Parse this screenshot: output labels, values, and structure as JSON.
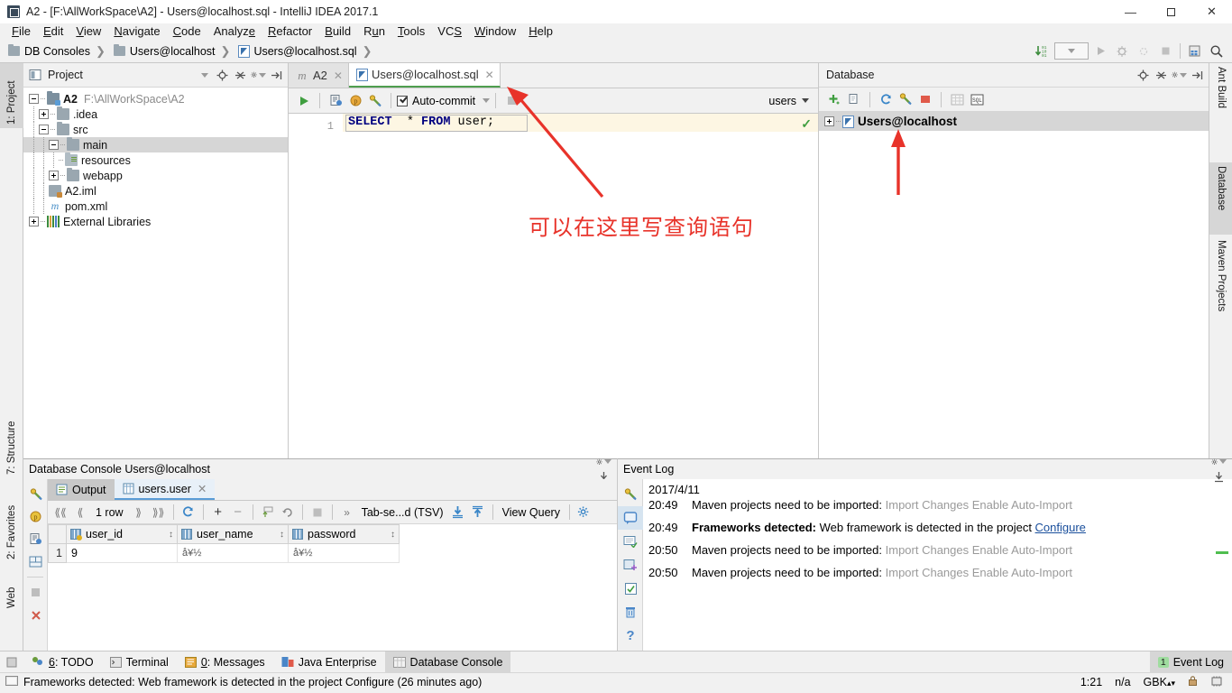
{
  "window": {
    "title": "A2 - [F:\\AllWorkSpace\\A2] - Users@localhost.sql - IntelliJ IDEA 2017.1",
    "minimize": "—",
    "maximize": "❐",
    "close": "✕"
  },
  "menu": [
    "File",
    "Edit",
    "View",
    "Navigate",
    "Code",
    "Analyze",
    "Refactor",
    "Build",
    "Run",
    "Tools",
    "VCS",
    "Window",
    "Help"
  ],
  "breadcrumb": [
    "DB Consoles",
    "Users@localhost",
    "Users@localhost.sql"
  ],
  "left_strip": [
    "1: Project",
    "7: Structure",
    "2: Favorites",
    "Web"
  ],
  "right_strip": [
    "Ant Build",
    "Database",
    "Maven Projects"
  ],
  "project": {
    "title": "Project",
    "tree": [
      {
        "label": "A2",
        "path": "F:\\AllWorkSpace\\A2",
        "icon": "module-icon",
        "bold": true,
        "depth": 0,
        "expander": "minus"
      },
      {
        "label": ".idea",
        "path": "",
        "icon": "folder-icon",
        "bold": false,
        "depth": 1,
        "expander": "plus"
      },
      {
        "label": "src",
        "path": "",
        "icon": "folder-icon",
        "bold": false,
        "depth": 1,
        "expander": "minus"
      },
      {
        "label": "main",
        "path": "",
        "icon": "folder-icon",
        "bold": false,
        "depth": 2,
        "expander": "minus",
        "selected": true
      },
      {
        "label": "resources",
        "path": "",
        "icon": "resources-folder-icon",
        "bold": false,
        "depth": 3,
        "expander": "none"
      },
      {
        "label": "webapp",
        "path": "",
        "icon": "folder-icon",
        "bold": false,
        "depth": 3,
        "expander": "plus"
      },
      {
        "label": "A2.iml",
        "path": "",
        "icon": "iml-file-icon",
        "bold": false,
        "depth": 1,
        "expander": "none"
      },
      {
        "label": "pom.xml",
        "path": "",
        "icon": "maven-pom-icon",
        "bold": false,
        "depth": 1,
        "expander": "none"
      },
      {
        "label": "External Libraries",
        "path": "",
        "icon": "library-icon",
        "bold": false,
        "depth": 0,
        "expander": "plus"
      }
    ]
  },
  "editor": {
    "tabs": [
      {
        "label": "A2",
        "icon": "maven-icon",
        "active": false
      },
      {
        "label": "Users@localhost.sql",
        "icon": "sql-file-icon",
        "active": true
      }
    ],
    "toolbar": {
      "autocommit_label": "Auto-commit",
      "schema": "users"
    },
    "line_number": "1",
    "code": {
      "keyword1": "SELECT",
      "star": "*",
      "keyword2": "FROM",
      "table": "user",
      "semicolon": ";",
      "full": "SELECT  * FROM user;"
    }
  },
  "database_panel": {
    "title": "Database",
    "node": "Users@localhost"
  },
  "console": {
    "title": "Database Console Users@localhost",
    "tabs": [
      {
        "label": "Output",
        "icon": "output-icon"
      },
      {
        "label": "users.user",
        "icon": "table-icon"
      }
    ],
    "toolbar": {
      "row_count": "1 row",
      "format": "Tab-se...d (TSV)",
      "view_query": "View Query"
    },
    "grid": {
      "columns": [
        "user_id",
        "user_name",
        "password"
      ],
      "rows": [
        {
          "num": "1",
          "cells": [
            "9",
            "å¥½",
            "å¥½"
          ]
        }
      ]
    }
  },
  "event_log": {
    "title": "Event Log",
    "date": "2017/4/11",
    "entries": [
      {
        "time": "20:49",
        "bold": "",
        "text": "Maven projects need to be imported: ",
        "dim": "Import Changes Enable Auto-Import",
        "link": ""
      },
      {
        "time": "20:49",
        "bold": "Frameworks detected:",
        "text": " Web framework is detected in the project ",
        "dim": "",
        "link": "Configure"
      },
      {
        "time": "20:50",
        "bold": "",
        "text": "Maven projects need to be imported: ",
        "dim": "Import Changes Enable Auto-Import",
        "link": ""
      },
      {
        "time": "20:50",
        "bold": "",
        "text": "Maven projects need to be imported: ",
        "dim": "Import Changes Enable Auto-Import",
        "link": ""
      }
    ]
  },
  "bottom_bar": {
    "buttons": [
      {
        "label": "6: TODO",
        "icon": "todo-icon",
        "active": false
      },
      {
        "label": "Terminal",
        "icon": "terminal-icon",
        "active": false
      },
      {
        "label": "0: Messages",
        "icon": "messages-icon",
        "active": false
      },
      {
        "label": "Java Enterprise",
        "icon": "java-enterprise-icon",
        "active": false
      },
      {
        "label": "Database Console",
        "icon": "database-console-icon",
        "active": true
      }
    ],
    "event_log_label": "Event Log",
    "event_log_badge": "1"
  },
  "status_bar": {
    "message": "Frameworks detected: Web framework is detected in the project Configure (26 minutes ago)",
    "caret": "1:21",
    "na": "n/a",
    "encoding": "GBK"
  },
  "annotation": {
    "text": "可以在这里写查询语句",
    "color": "#e8332a"
  },
  "colors": {
    "accent_green": "#4f9e4f",
    "link": "#1a4f9c",
    "keyword": "#000080",
    "highlight_line": "#fdf6e3"
  }
}
